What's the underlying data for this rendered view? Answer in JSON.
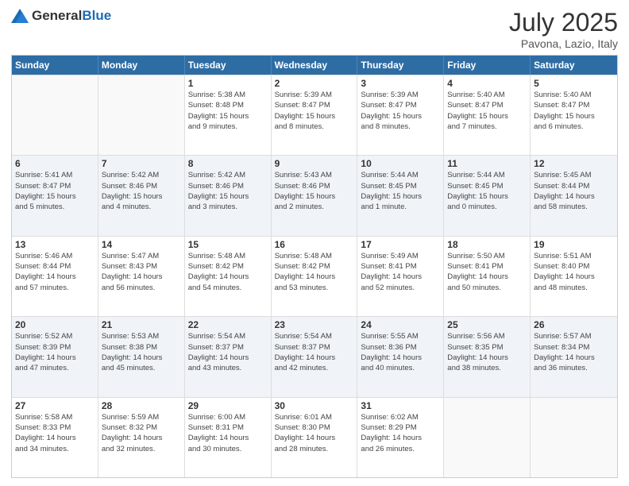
{
  "header": {
    "logo_general": "General",
    "logo_blue": "Blue",
    "title": "July 2025",
    "location": "Pavona, Lazio, Italy"
  },
  "days_of_week": [
    "Sunday",
    "Monday",
    "Tuesday",
    "Wednesday",
    "Thursday",
    "Friday",
    "Saturday"
  ],
  "weeks": [
    [
      {
        "day": "",
        "info": ""
      },
      {
        "day": "",
        "info": ""
      },
      {
        "day": "1",
        "info": "Sunrise: 5:38 AM\nSunset: 8:48 PM\nDaylight: 15 hours\nand 9 minutes."
      },
      {
        "day": "2",
        "info": "Sunrise: 5:39 AM\nSunset: 8:47 PM\nDaylight: 15 hours\nand 8 minutes."
      },
      {
        "day": "3",
        "info": "Sunrise: 5:39 AM\nSunset: 8:47 PM\nDaylight: 15 hours\nand 8 minutes."
      },
      {
        "day": "4",
        "info": "Sunrise: 5:40 AM\nSunset: 8:47 PM\nDaylight: 15 hours\nand 7 minutes."
      },
      {
        "day": "5",
        "info": "Sunrise: 5:40 AM\nSunset: 8:47 PM\nDaylight: 15 hours\nand 6 minutes."
      }
    ],
    [
      {
        "day": "6",
        "info": "Sunrise: 5:41 AM\nSunset: 8:47 PM\nDaylight: 15 hours\nand 5 minutes."
      },
      {
        "day": "7",
        "info": "Sunrise: 5:42 AM\nSunset: 8:46 PM\nDaylight: 15 hours\nand 4 minutes."
      },
      {
        "day": "8",
        "info": "Sunrise: 5:42 AM\nSunset: 8:46 PM\nDaylight: 15 hours\nand 3 minutes."
      },
      {
        "day": "9",
        "info": "Sunrise: 5:43 AM\nSunset: 8:46 PM\nDaylight: 15 hours\nand 2 minutes."
      },
      {
        "day": "10",
        "info": "Sunrise: 5:44 AM\nSunset: 8:45 PM\nDaylight: 15 hours\nand 1 minute."
      },
      {
        "day": "11",
        "info": "Sunrise: 5:44 AM\nSunset: 8:45 PM\nDaylight: 15 hours\nand 0 minutes."
      },
      {
        "day": "12",
        "info": "Sunrise: 5:45 AM\nSunset: 8:44 PM\nDaylight: 14 hours\nand 58 minutes."
      }
    ],
    [
      {
        "day": "13",
        "info": "Sunrise: 5:46 AM\nSunset: 8:44 PM\nDaylight: 14 hours\nand 57 minutes."
      },
      {
        "day": "14",
        "info": "Sunrise: 5:47 AM\nSunset: 8:43 PM\nDaylight: 14 hours\nand 56 minutes."
      },
      {
        "day": "15",
        "info": "Sunrise: 5:48 AM\nSunset: 8:42 PM\nDaylight: 14 hours\nand 54 minutes."
      },
      {
        "day": "16",
        "info": "Sunrise: 5:48 AM\nSunset: 8:42 PM\nDaylight: 14 hours\nand 53 minutes."
      },
      {
        "day": "17",
        "info": "Sunrise: 5:49 AM\nSunset: 8:41 PM\nDaylight: 14 hours\nand 52 minutes."
      },
      {
        "day": "18",
        "info": "Sunrise: 5:50 AM\nSunset: 8:41 PM\nDaylight: 14 hours\nand 50 minutes."
      },
      {
        "day": "19",
        "info": "Sunrise: 5:51 AM\nSunset: 8:40 PM\nDaylight: 14 hours\nand 48 minutes."
      }
    ],
    [
      {
        "day": "20",
        "info": "Sunrise: 5:52 AM\nSunset: 8:39 PM\nDaylight: 14 hours\nand 47 minutes."
      },
      {
        "day": "21",
        "info": "Sunrise: 5:53 AM\nSunset: 8:38 PM\nDaylight: 14 hours\nand 45 minutes."
      },
      {
        "day": "22",
        "info": "Sunrise: 5:54 AM\nSunset: 8:37 PM\nDaylight: 14 hours\nand 43 minutes."
      },
      {
        "day": "23",
        "info": "Sunrise: 5:54 AM\nSunset: 8:37 PM\nDaylight: 14 hours\nand 42 minutes."
      },
      {
        "day": "24",
        "info": "Sunrise: 5:55 AM\nSunset: 8:36 PM\nDaylight: 14 hours\nand 40 minutes."
      },
      {
        "day": "25",
        "info": "Sunrise: 5:56 AM\nSunset: 8:35 PM\nDaylight: 14 hours\nand 38 minutes."
      },
      {
        "day": "26",
        "info": "Sunrise: 5:57 AM\nSunset: 8:34 PM\nDaylight: 14 hours\nand 36 minutes."
      }
    ],
    [
      {
        "day": "27",
        "info": "Sunrise: 5:58 AM\nSunset: 8:33 PM\nDaylight: 14 hours\nand 34 minutes."
      },
      {
        "day": "28",
        "info": "Sunrise: 5:59 AM\nSunset: 8:32 PM\nDaylight: 14 hours\nand 32 minutes."
      },
      {
        "day": "29",
        "info": "Sunrise: 6:00 AM\nSunset: 8:31 PM\nDaylight: 14 hours\nand 30 minutes."
      },
      {
        "day": "30",
        "info": "Sunrise: 6:01 AM\nSunset: 8:30 PM\nDaylight: 14 hours\nand 28 minutes."
      },
      {
        "day": "31",
        "info": "Sunrise: 6:02 AM\nSunset: 8:29 PM\nDaylight: 14 hours\nand 26 minutes."
      },
      {
        "day": "",
        "info": ""
      },
      {
        "day": "",
        "info": ""
      }
    ]
  ]
}
